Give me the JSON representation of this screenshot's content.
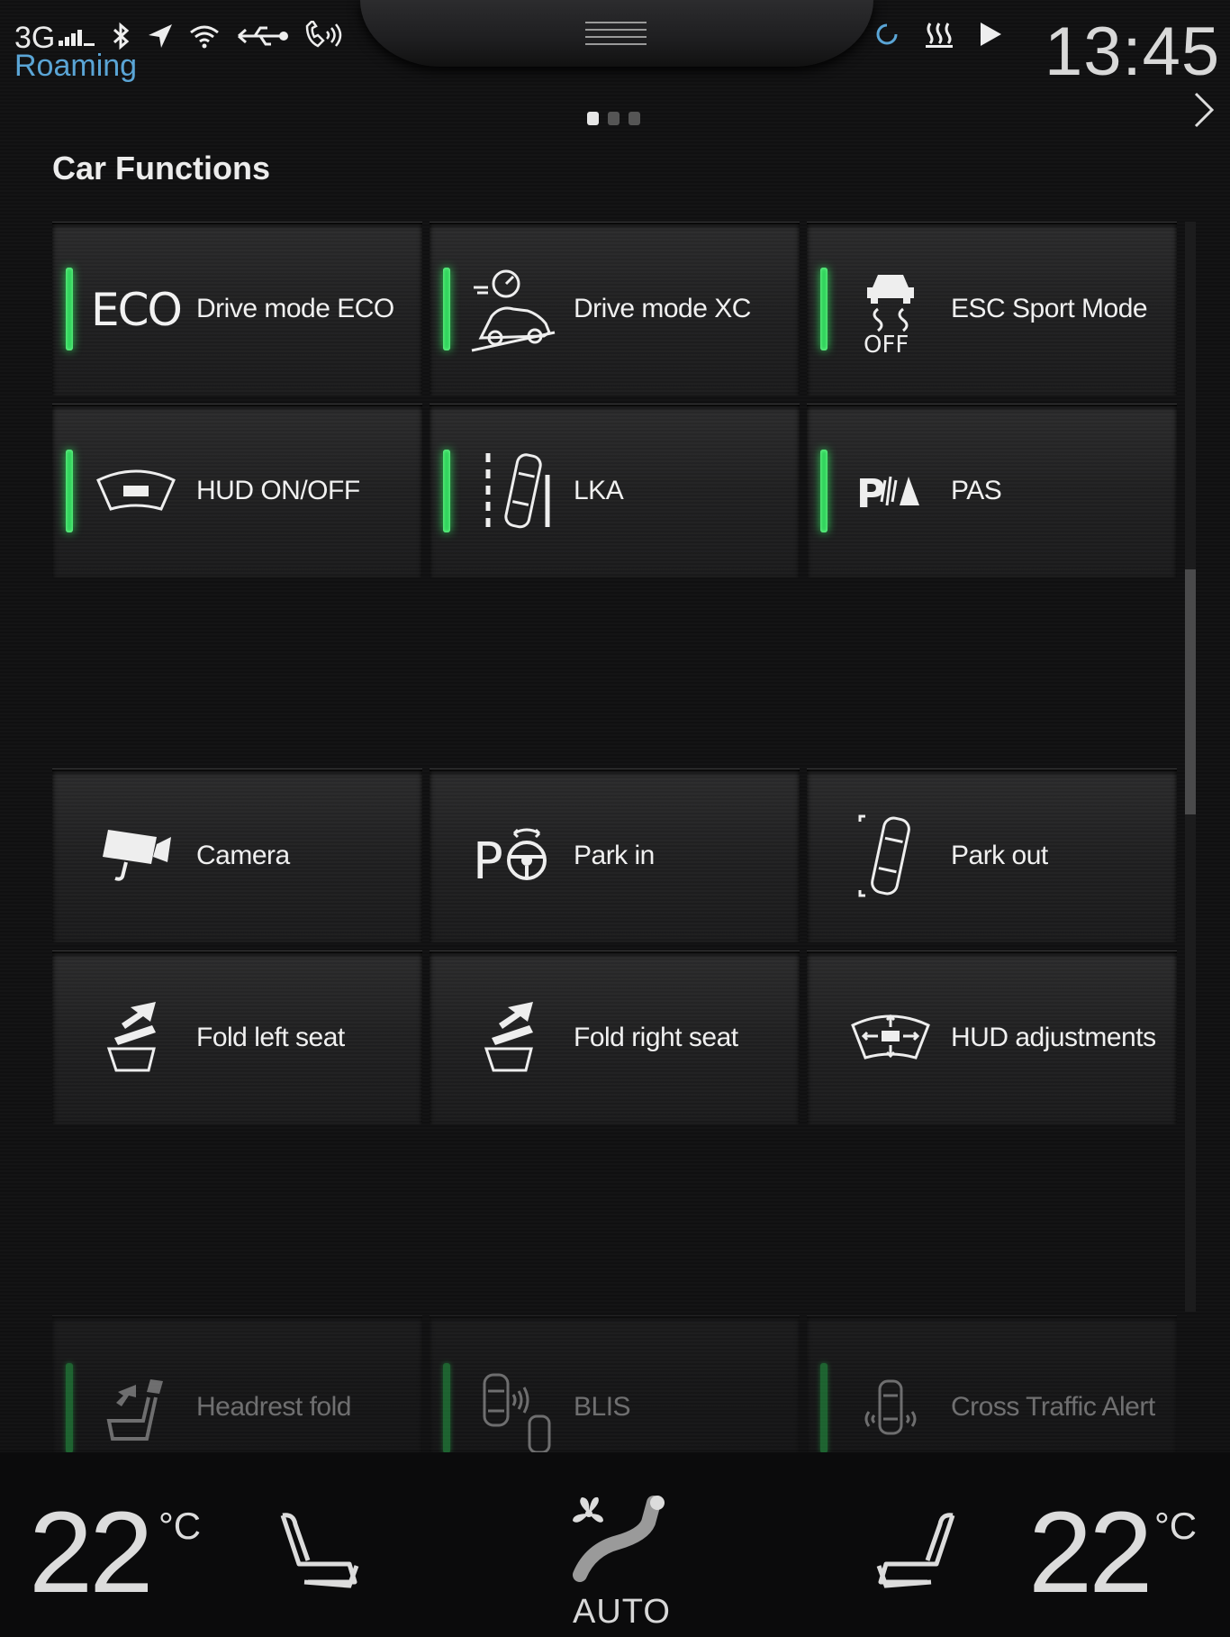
{
  "status": {
    "network": "3G",
    "roaming": "Roaming",
    "time": "13:45",
    "icons": [
      "signal-bars-icon",
      "bluetooth-icon",
      "location-icon",
      "wifi-icon",
      "usb-icon",
      "phone-handsfree-icon",
      "refresh-icon",
      "rear-defrost-icon",
      "play-icon"
    ]
  },
  "pager": {
    "count": 3,
    "active": 0
  },
  "page": {
    "title": "Car Functions"
  },
  "tiles": [
    {
      "label": "Drive mode ECO",
      "icon": "eco-icon",
      "active": true
    },
    {
      "label": "Drive mode XC",
      "icon": "offroad-car-icon",
      "active": true
    },
    {
      "label": "ESC Sport Mode",
      "icon": "esc-off-icon",
      "active": true
    },
    {
      "label": "HUD ON/OFF",
      "icon": "hud-icon",
      "active": true
    },
    {
      "label": "LKA",
      "icon": "lane-keeping-icon",
      "active": true
    },
    {
      "label": "PAS",
      "icon": "parking-assist-icon",
      "active": true
    },
    {
      "label": "Camera",
      "icon": "camera-icon",
      "active": false
    },
    {
      "label": "Park in",
      "icon": "park-in-icon",
      "active": false
    },
    {
      "label": "Park out",
      "icon": "park-out-icon",
      "active": false
    },
    {
      "label": "Fold left seat",
      "icon": "fold-seat-icon",
      "active": false
    },
    {
      "label": "Fold right seat",
      "icon": "fold-seat-icon",
      "active": false
    },
    {
      "label": "HUD adjustments",
      "icon": "hud-adjust-icon",
      "active": false
    },
    {
      "label": "Headrest fold",
      "icon": "headrest-icon",
      "active": true
    },
    {
      "label": "BLIS",
      "icon": "blis-icon",
      "active": true
    },
    {
      "label": "Cross Traffic Alert",
      "icon": "cross-traffic-icon",
      "active": true
    }
  ],
  "climate": {
    "left_temp": "22",
    "right_temp": "22",
    "unit": "°C",
    "mode": "AUTO"
  },
  "colors": {
    "indicator": "#2fd35a",
    "roaming": "#5aa5d6",
    "background": "#111112"
  }
}
